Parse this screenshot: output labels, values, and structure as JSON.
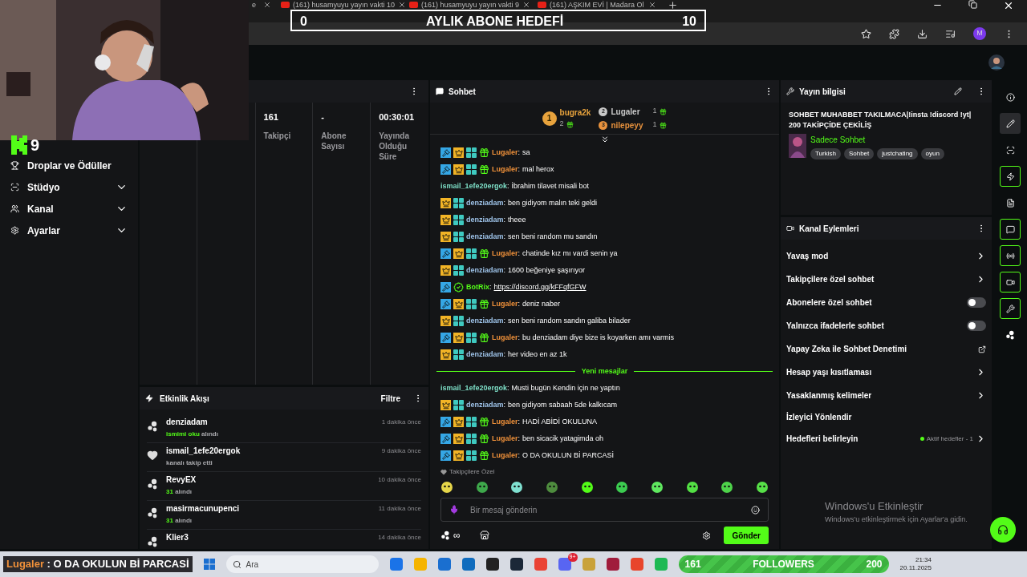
{
  "browser": {
    "tabs": [
      {
        "title": "e",
        "selected": false
      },
      {
        "title": "(161) husamyuyu yayın vakti 10",
        "selected": false
      },
      {
        "title": "(161) husamyuyu yayın vakti 9",
        "selected": false
      },
      {
        "title": "(161) AŞKIM EVİ | Madara Ol",
        "selected": false
      }
    ],
    "avatar_letter": "M"
  },
  "goal_overlay": {
    "start": "0",
    "title": "AYLIK ABONE HEDEFİ",
    "target": "10"
  },
  "kick_badge": {
    "count": "9"
  },
  "sidebar": {
    "items": [
      {
        "label": "Droplar ve Ödüller",
        "kind": "plain"
      },
      {
        "label": "Stüdyo",
        "kind": "group"
      },
      {
        "label": "Kanal",
        "kind": "group"
      },
      {
        "label": "Ayarlar",
        "kind": "group"
      }
    ]
  },
  "stats": [
    {
      "value": "161",
      "label": "Takipçi"
    },
    {
      "value": "-",
      "label": "Abone Sayısı"
    },
    {
      "value": "00:30:01",
      "label": "Yayında Olduğu Süre"
    }
  ],
  "activity": {
    "title": "Etkinlik Akışı",
    "filter": "Filtre",
    "events": [
      {
        "kind": "reward",
        "user": "denziadam",
        "highlight": "ismimi oku",
        "action": "alındı",
        "time": "1 dakika önce"
      },
      {
        "kind": "follow",
        "user": "ismail_1efe20ergok",
        "action": "kanalı takip etti",
        "time": "9 dakika önce"
      },
      {
        "kind": "reward",
        "user": "RevyEX",
        "highlight": "31",
        "action": "alındı",
        "time": "10 dakika önce"
      },
      {
        "kind": "reward",
        "user": "masirmacunupenci",
        "highlight": "31",
        "action": "alındı",
        "time": "11 dakika önce"
      },
      {
        "kind": "reward",
        "user": "Klier3",
        "time": "14 dakika önce"
      }
    ]
  },
  "chat": {
    "title": "Sohbet",
    "leaders": [
      {
        "rank": "1",
        "name": "bugra2k",
        "count": "2",
        "color": "#e8a33d"
      },
      {
        "rank": "2",
        "name": "Lugaler",
        "count": "1",
        "color": "#c9c9c9"
      },
      {
        "rank": "3",
        "name": "nilepeyy",
        "count": "1",
        "color": "#e8923d"
      }
    ],
    "messages": [
      {
        "kind": "message",
        "badges": [
          {
            "kind": "mod"
          },
          {
            "kind": "sub"
          },
          {
            "kind": "og"
          },
          {
            "kind": "gift"
          }
        ],
        "user": "Lugaler",
        "color": "#f0913a",
        "separator": ":",
        "text": "sa"
      },
      {
        "kind": "message",
        "badges": [
          {
            "kind": "mod"
          },
          {
            "kind": "sub"
          },
          {
            "kind": "og"
          },
          {
            "kind": "gift"
          }
        ],
        "user": "Lugaler",
        "color": "#f0913a",
        "separator": ":",
        "text": "mal herox"
      },
      {
        "kind": "message",
        "user": "ismail_1efe20ergok",
        "color": "#7ee0c8",
        "separator": ":",
        "text": "İbrahim tilavet misali bot"
      },
      {
        "kind": "message",
        "badges": [
          {
            "kind": "sub"
          },
          {
            "kind": "og"
          }
        ],
        "user": "denziadam",
        "color": "#9fc4ea",
        "separator": ":",
        "text": "ben gidiyom malın teki geldi"
      },
      {
        "kind": "message",
        "badges": [
          {
            "kind": "sub"
          },
          {
            "kind": "og"
          }
        ],
        "user": "denziadam",
        "color": "#9fc4ea",
        "separator": ":",
        "text": "theee"
      },
      {
        "kind": "message",
        "badges": [
          {
            "kind": "sub"
          },
          {
            "kind": "og"
          }
        ],
        "user": "denziadam",
        "color": "#9fc4ea",
        "separator": ":",
        "text": "sen beni random mu sandın"
      },
      {
        "kind": "message",
        "badges": [
          {
            "kind": "mod"
          },
          {
            "kind": "sub"
          },
          {
            "kind": "og"
          },
          {
            "kind": "gift"
          }
        ],
        "user": "Lugaler",
        "color": "#f0913a",
        "separator": ":",
        "text": "chatinde kız mı vardi senin ya"
      },
      {
        "kind": "message",
        "badges": [
          {
            "kind": "sub"
          },
          {
            "kind": "og"
          }
        ],
        "user": "denziadam",
        "color": "#9fc4ea",
        "separator": ":",
        "text": "1600 beğeniye şaşırıyor"
      },
      {
        "kind": "link",
        "badges": [
          {
            "kind": "mod"
          },
          {
            "kind": "verified"
          }
        ],
        "user": "BotRix",
        "color": "#53fc18",
        "separator": ":",
        "text": "https://discord.gg/kFFqfGFW"
      },
      {
        "kind": "message",
        "badges": [
          {
            "kind": "mod"
          },
          {
            "kind": "sub"
          },
          {
            "kind": "og"
          },
          {
            "kind": "gift"
          }
        ],
        "user": "Lugaler",
        "color": "#f0913a",
        "separator": ":",
        "text": "deniz naber"
      },
      {
        "kind": "message",
        "badges": [
          {
            "kind": "sub"
          },
          {
            "kind": "og"
          }
        ],
        "user": "denziadam",
        "color": "#9fc4ea",
        "separator": ":",
        "text": "sen beni random sandın galiba bilader"
      },
      {
        "kind": "message",
        "badges": [
          {
            "kind": "mod"
          },
          {
            "kind": "sub"
          },
          {
            "kind": "og"
          },
          {
            "kind": "gift"
          }
        ],
        "user": "Lugaler",
        "color": "#f0913a",
        "separator": ":",
        "text": "bu denziadam diye bize is koyarken amı varmis"
      },
      {
        "kind": "message",
        "badges": [
          {
            "kind": "sub"
          },
          {
            "kind": "og"
          }
        ],
        "user": "denziadam",
        "color": "#9fc4ea",
        "separator": ":",
        "text": "her video en az 1k"
      },
      {
        "kind": "divider",
        "text": "Yeni mesajlar"
      },
      {
        "kind": "message",
        "user": "ismail_1efe20ergok",
        "color": "#7ee0c8",
        "separator": ":",
        "text": "Musti bugün Kendin için ne yaptın"
      },
      {
        "kind": "message",
        "badges": [
          {
            "kind": "sub"
          },
          {
            "kind": "og"
          }
        ],
        "user": "denziadam",
        "color": "#9fc4ea",
        "separator": ":",
        "text": "ben gidiyom sabaah 5de kalkıcam"
      },
      {
        "kind": "message",
        "badges": [
          {
            "kind": "mod"
          },
          {
            "kind": "sub"
          },
          {
            "kind": "og"
          },
          {
            "kind": "gift"
          }
        ],
        "user": "Lugaler",
        "color": "#f0913a",
        "separator": ":",
        "text": "HADİ ABİDİ OKULUNA"
      },
      {
        "kind": "message",
        "badges": [
          {
            "kind": "mod"
          },
          {
            "kind": "sub"
          },
          {
            "kind": "og"
          },
          {
            "kind": "gift"
          }
        ],
        "user": "Lugaler",
        "color": "#f0913a",
        "separator": ":",
        "text": "ben sicacik yatagimda oh"
      },
      {
        "kind": "message",
        "badges": [
          {
            "kind": "mod"
          },
          {
            "kind": "sub"
          },
          {
            "kind": "og"
          },
          {
            "kind": "gift"
          }
        ],
        "user": "Lugaler",
        "color": "#f0913a",
        "separator": ":",
        "text": "O DA OKULUN Bİ PARCASİ"
      }
    ],
    "emote_label": "Takipçilere Özel",
    "input": {
      "placeholder": "Bir mesaj gönderin"
    },
    "points": "∞",
    "send": "Gönder"
  },
  "stream_info": {
    "title": "Yayın bilgisi",
    "lines": [
      "SOHBET MUHABBET TAKILMACA|!insta !discord !yt|",
      "200 TAKİPÇİDE ÇEKİLİŞ"
    ],
    "category": "Sadece Sohbet",
    "tags": [
      "Turkish",
      "Sohbet",
      "justchating",
      "oyun"
    ]
  },
  "channel_actions": {
    "title": "Kanal Eylemleri",
    "items": [
      {
        "kind": "chevron",
        "label": "Yavaş mod"
      },
      {
        "kind": "chevron",
        "label": "Takipçilere özel sohbet"
      },
      {
        "kind": "toggle",
        "label": "Abonelere özel sohbet",
        "on": false
      },
      {
        "kind": "toggle",
        "label": "Yalnızca ifadelerle sohbet",
        "on": false
      },
      {
        "kind": "external",
        "label": "Yapay Zeka ile Sohbet Denetimi"
      },
      {
        "kind": "chevron",
        "label": "Hesap yaşı kısıtlaması"
      },
      {
        "kind": "chevron",
        "label": "Yasaklanmış kelimeler"
      },
      {
        "kind": "plain",
        "label": "İzleyici Yönlendir"
      },
      {
        "kind": "status",
        "label": "Hedefleri belirleyin",
        "status": "Aktif hedefler - 1"
      }
    ]
  },
  "rail": [
    {
      "selected": false,
      "highlighted": false
    },
    {
      "selected": true,
      "highlighted": false
    },
    {
      "selected": false,
      "highlighted": false
    },
    {
      "selected": false,
      "highlighted": true
    },
    {
      "selected": false,
      "highlighted": false
    },
    {
      "selected": false,
      "highlighted": true
    },
    {
      "selected": false,
      "highlighted": true
    },
    {
      "selected": false,
      "highlighted": true
    },
    {
      "selected": false,
      "highlighted": true
    },
    {
      "selected": false,
      "highlighted": false
    }
  ],
  "activation": {
    "title": "Windows'u Etkinleştir",
    "subtitle": "Windows'u etkinleştirmek için Ayarlar'a gidin."
  },
  "taskbar": {
    "ticker_user": "Lugaler",
    "ticker_text": ": O DA OKULUN Bİ PARCASİ",
    "search": "Ara",
    "badge": "9+",
    "followers": {
      "current": "161",
      "label": "FOLLOWERS",
      "goal": "200"
    },
    "time": "21:34",
    "date": "20.11.2025"
  }
}
